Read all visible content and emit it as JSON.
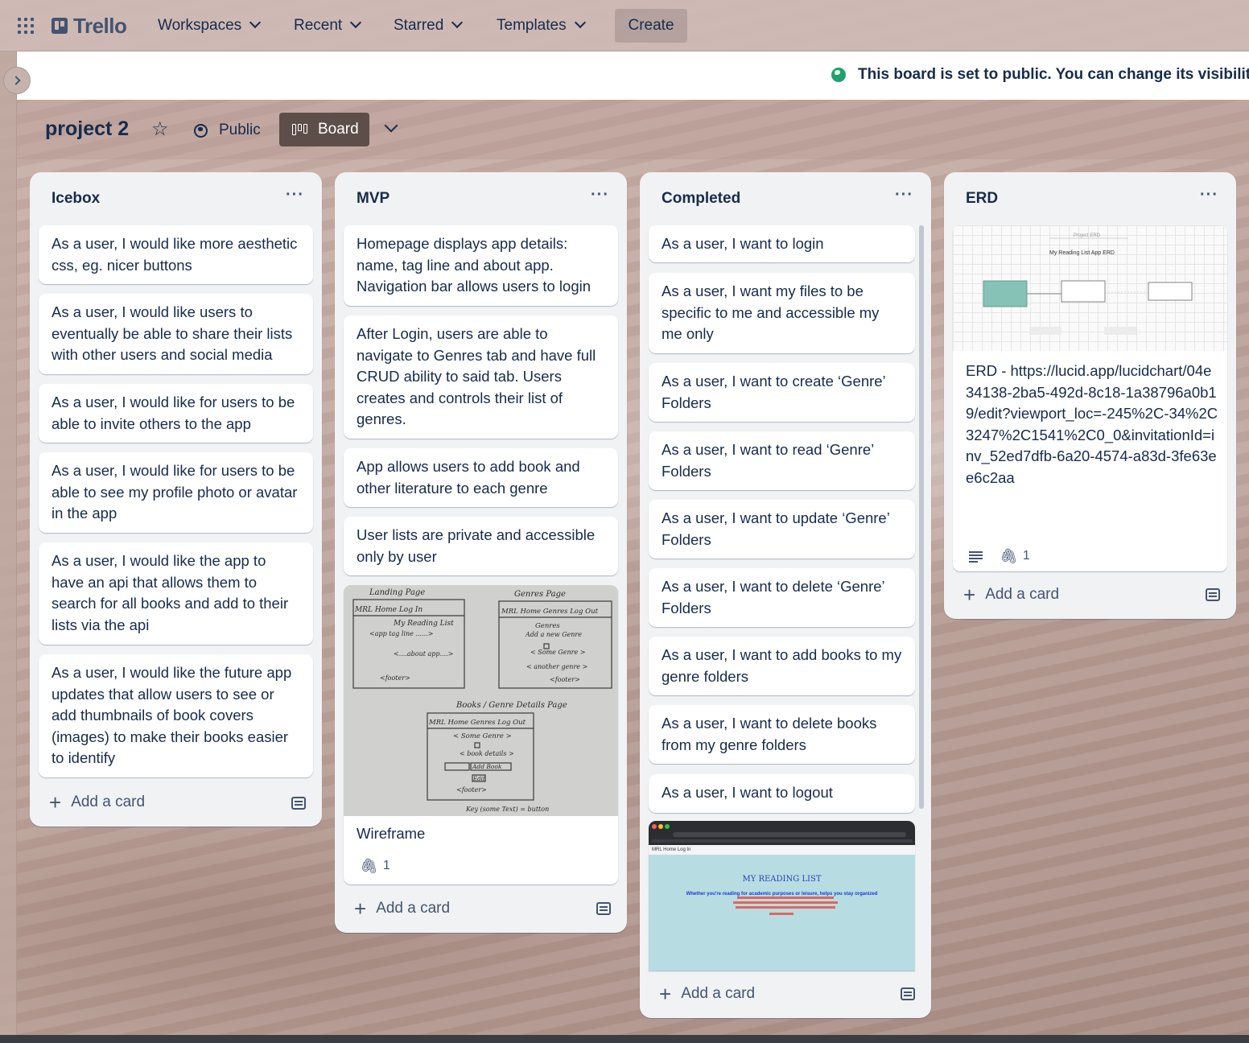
{
  "topnav": {
    "logo": "Trello",
    "workspaces": "Workspaces",
    "recent": "Recent",
    "starred": "Starred",
    "templates": "Templates",
    "create": "Create"
  },
  "banner": {
    "text": "This board is set to public. You can change its visibility"
  },
  "board": {
    "title": "project 2",
    "visibility": "Public",
    "view": "Board"
  },
  "lists": [
    {
      "title": "Icebox",
      "menu": "···",
      "cards": [
        "As a user, I would like more aesthetic css, eg. nicer buttons",
        "As a user, I would like users to eventually be able to share their lists with other users and social media",
        "As a user, I would like for users to be able to invite others to the app",
        "As a user, I would like for users to be able to see my profile photo or avatar in the app",
        "As a user, I would like the app to have an api that allows them to search for all books and add to their lists via the api",
        "As a user, I would like the future app updates that allow users to see or add thumbnails of book covers (images) to make their books easier to identify"
      ],
      "add_card": "Add a card"
    },
    {
      "title": "MVP",
      "menu": "···",
      "cards": [
        "Homepage displays app details: name, tag line and about app. Navigation bar allows users to login",
        "After Login, users are able to navigate to Genres tab and have full CRUD ability to said tab. Users creates and controls their list of genres.",
        "App allows users to add book and other literature to each genre",
        "User lists are private and accessible only by user"
      ],
      "wireframe_card": {
        "title": "Wireframe",
        "attachments": "1",
        "sketch": {
          "landing_page": "Landing Page",
          "genres_page": "Genres Page",
          "details_page": "Books / Genre Details Page",
          "nav_home": "MRL  Home  Log In",
          "nav_genres": "MRL  Home  Genres  Log Out",
          "my_reading_list": "My Reading List",
          "tag_line": "<app tag line ......>",
          "about_app": "<....about app....>",
          "footer": "<footer>",
          "genres": "Genres",
          "add_new_genre": "Add a new Genre",
          "some_genre": "< Some Genre >",
          "another_genre": "< another genre >",
          "book_details": "< book details >",
          "add_book": "Add Book",
          "edit": "Edit",
          "key": "Key  (some Text) = button"
        }
      },
      "add_card": "Add a card"
    },
    {
      "title": "Completed",
      "menu": "···",
      "cards": [
        "As a user, I want to login",
        "As a user, I want my files to be specific to me and accessible my me only",
        "As a user, I want to create ‘Genre’ Folders",
        "As a user, I want to read ‘Genre’ Folders",
        "As a user, I want to update ‘Genre’ Folders",
        "As a user, I want to delete ‘Genre’ Folders",
        "As a user, I want to add books to my genre folders",
        "As a user, I want to delete books from my genre folders",
        "As a user, I want to logout"
      ],
      "screenshot_card": {
        "app_title": "MY READING LIST",
        "app_tagline": "Whether you're reading for academic purposes or leisure, helps you stay organized",
        "nav": "MRL  Home  Log In"
      },
      "add_card": "Add a card"
    },
    {
      "title": "ERD",
      "menu": "···",
      "erd_card": {
        "text": "ERD - https://lucid.app/lucidchart/04e34138-2ba5-492d-8c18-1a38796a0b19/edit?viewport_loc=-245%2C-34%2C3247%2C1541%2C0_0&invitationId=inv_52ed7dfb-6a20-4574-a83d-3fe63ee6c2aa",
        "attachments": "1",
        "diagram_label": "Project ERD",
        "diagram_title": "My Reading List  App ERD"
      },
      "add_card": "Add a card"
    }
  ]
}
